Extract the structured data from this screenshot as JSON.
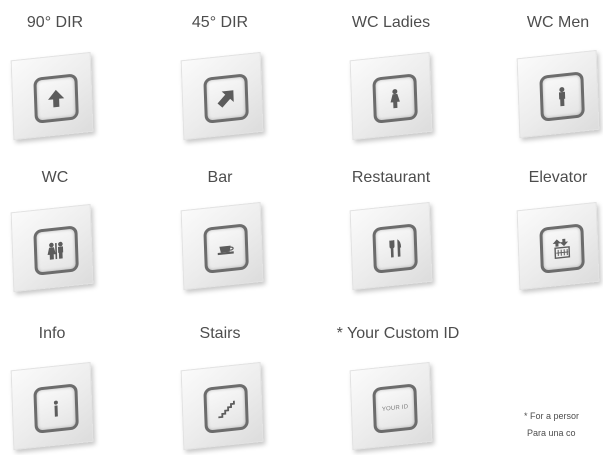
{
  "items": [
    {
      "label": "90° DIR",
      "icon": "arrow-up-icon"
    },
    {
      "label": "45° DIR",
      "icon": "arrow-diagonal-icon"
    },
    {
      "label": "WC Ladies",
      "icon": "woman-icon"
    },
    {
      "label": "WC Men",
      "icon": "man-icon"
    },
    {
      "label": "WC",
      "icon": "wc-people-icon"
    },
    {
      "label": "Bar",
      "icon": "coffee-cup-icon"
    },
    {
      "label": "Restaurant",
      "icon": "fork-knife-icon"
    },
    {
      "label": "Elevator",
      "icon": "elevator-icon"
    },
    {
      "label": "Info",
      "icon": "info-icon"
    },
    {
      "label": "Stairs",
      "icon": "stairs-icon"
    },
    {
      "label": "* Your Custom ID",
      "icon": "custom-id-icon",
      "icon_text": "YOUR ID"
    }
  ],
  "footnote": {
    "line1": "* For a persor",
    "line2": "Para una co"
  }
}
